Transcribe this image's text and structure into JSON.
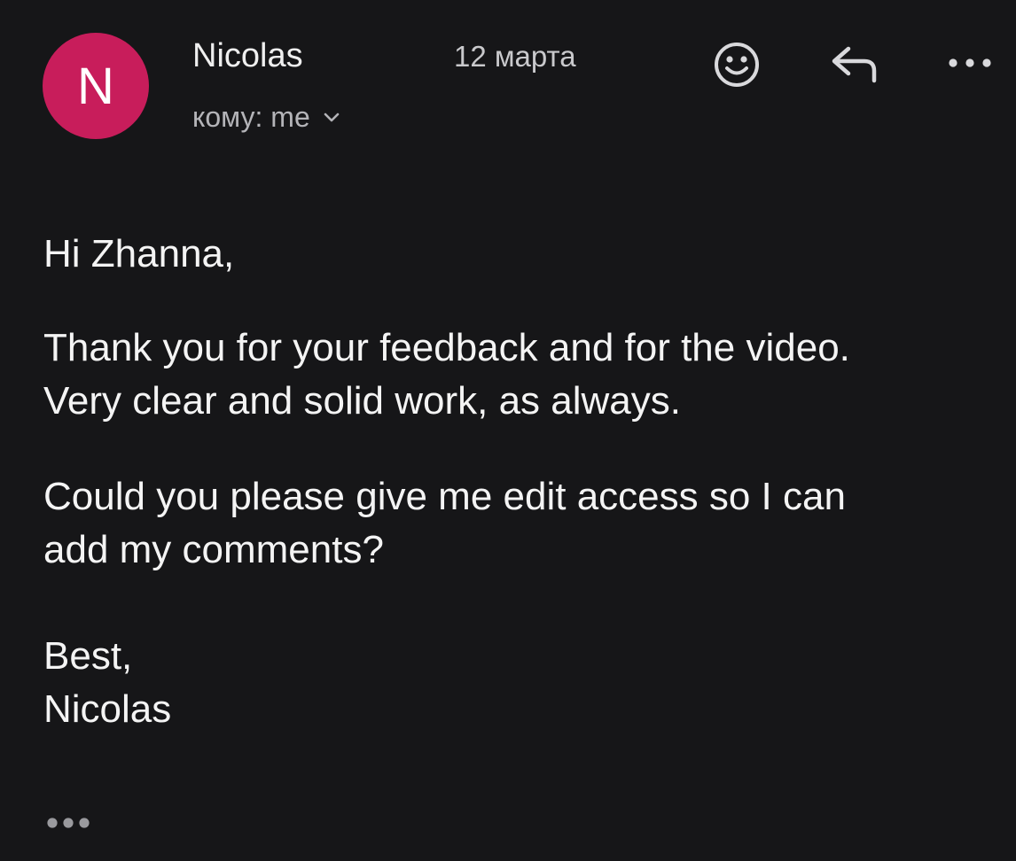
{
  "header": {
    "avatar_letter": "N",
    "avatar_color": "#c81d5b",
    "sender_name": "Nicolas",
    "date": "12 марта",
    "recipient": "кому: me",
    "actions": {
      "emoji_icon": "smiley-face-icon",
      "reply_icon": "reply-arrow-icon",
      "more_icon": "more-horizontal-icon"
    }
  },
  "message": {
    "greeting": "Hi Zhanna,",
    "paragraph1_line1": "Thank you for your feedback and for the video.",
    "paragraph1_line2": "Very clear and solid work, as always.",
    "paragraph2_line1": "Could you please give me edit access so I can",
    "paragraph2_line2": "add my comments?",
    "signoff": "Best,",
    "signature": "Nicolas"
  },
  "footer": {
    "trimmed_icon": "show-trimmed-content-icon"
  }
}
